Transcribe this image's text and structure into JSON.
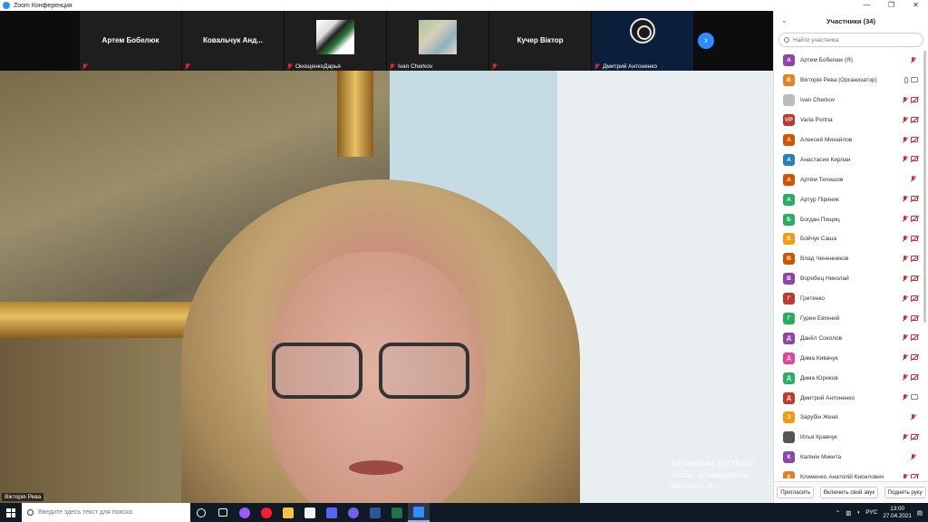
{
  "window": {
    "title": "Zoom Конференция",
    "controls": [
      "—",
      "❐",
      "✕"
    ]
  },
  "strip": {
    "tiles": [
      {
        "name": "Артем Бобелюк",
        "footer": ""
      },
      {
        "name": "Ковальчук  Анд...",
        "footer": ""
      },
      {
        "name": "",
        "footer": "ОнощенкоДарья"
      },
      {
        "name": "",
        "footer": "Ivan Cherkov"
      },
      {
        "name": "Кучер Віктор",
        "footer": ""
      },
      {
        "name": "",
        "footer": "Дмитрий Антоненко"
      }
    ],
    "next_glyph": "›"
  },
  "main_video": {
    "speaker_label": "Вікторія Рева",
    "watermark_line1": "Активация Windows",
    "watermark_line2": "Чтобы активировать Windows, п..."
  },
  "participants": {
    "title": "Участники (34)",
    "search_placeholder": "Найти участника",
    "list": [
      {
        "initial": "А",
        "name": "Артем Бобелюк (Я)",
        "color": "#8e44ad",
        "icons": "mic"
      },
      {
        "initial": "В",
        "name": "Вікторія Рева (Организатор)",
        "color": "#e67e22",
        "icons": "gray"
      },
      {
        "initial": "",
        "name": "Ivan Cherkov",
        "color": "#bcbcbc",
        "icons": "both"
      },
      {
        "initial": "VP",
        "name": "Varia Portna",
        "color": "#c0392b",
        "icons": "both"
      },
      {
        "initial": "А",
        "name": "Алексей Михайлов",
        "color": "#d35400",
        "icons": "both"
      },
      {
        "initial": "А",
        "name": "Анастасия Кирлан",
        "color": "#2980b9",
        "icons": "both"
      },
      {
        "initial": "А",
        "name": "Артём Телешов",
        "color": "#d35400",
        "icons": "mic"
      },
      {
        "initial": "А",
        "name": "Артур Піряник",
        "color": "#27ae60",
        "icons": "both"
      },
      {
        "initial": "Б",
        "name": "Богдан Пищиц",
        "color": "#27ae60",
        "icons": "both"
      },
      {
        "initial": "Б",
        "name": "Бойчук Саша",
        "color": "#f39c12",
        "icons": "both"
      },
      {
        "initial": "В",
        "name": "Влад Чиненников",
        "color": "#d35400",
        "icons": "both"
      },
      {
        "initial": "В",
        "name": "Воробец Николай",
        "color": "#8e44ad",
        "icons": "both"
      },
      {
        "initial": "Г",
        "name": "Гритенко",
        "color": "#c0392b",
        "icons": "both"
      },
      {
        "initial": "Г",
        "name": "Гурин Евгений",
        "color": "#27ae60",
        "icons": "both"
      },
      {
        "initial": "Д",
        "name": "Даніїл Соколов",
        "color": "#8e44ad",
        "icons": "both"
      },
      {
        "initial": "Д",
        "name": "Дима Кивачук",
        "color": "#e84393",
        "icons": "both"
      },
      {
        "initial": "Д",
        "name": "Дима Юриков",
        "color": "#27ae60",
        "icons": "both"
      },
      {
        "initial": "Д",
        "name": "Дмитрий Антоненко",
        "color": "#c0392b",
        "icons": "micgraycam"
      },
      {
        "initial": "З",
        "name": "Зарубін Женя",
        "color": "#f39c12",
        "icons": "mic"
      },
      {
        "initial": "",
        "name": "Илья Кравчук",
        "color": "#555555",
        "icons": "both"
      },
      {
        "initial": "К",
        "name": "Калінін Микита",
        "color": "#8e44ad",
        "icons": "mic"
      },
      {
        "initial": "К",
        "name": "Клименко Анатолій Кирилович",
        "color": "#e67e22",
        "icons": "both"
      }
    ],
    "footer": {
      "invite": "Пригласить",
      "unmute": "Включить свой звук",
      "raise_hand": "Поднять руку"
    }
  },
  "taskbar": {
    "search_placeholder": "Введите здесь текст для поиска",
    "lang": "РУС",
    "time": "13:00",
    "date": "27.04.2021",
    "apps": [
      {
        "name": "cortana-icon",
        "color": "#ffffff"
      },
      {
        "name": "task-view-icon",
        "color": "#ffffff"
      },
      {
        "name": "app-purple-icon",
        "color": "#9b59ff"
      },
      {
        "name": "opera-icon",
        "color": "#ff1b2d"
      },
      {
        "name": "file-explorer-icon",
        "color": "#f6c343"
      },
      {
        "name": "store-icon",
        "color": "#f2f2f2"
      },
      {
        "name": "discord-icon",
        "color": "#5865f2"
      },
      {
        "name": "viber-icon",
        "color": "#7360f2"
      },
      {
        "name": "word-icon",
        "color": "#2b579a"
      },
      {
        "name": "excel-icon",
        "color": "#217346"
      },
      {
        "name": "zoom-icon",
        "color": "#2d8cff"
      }
    ]
  }
}
